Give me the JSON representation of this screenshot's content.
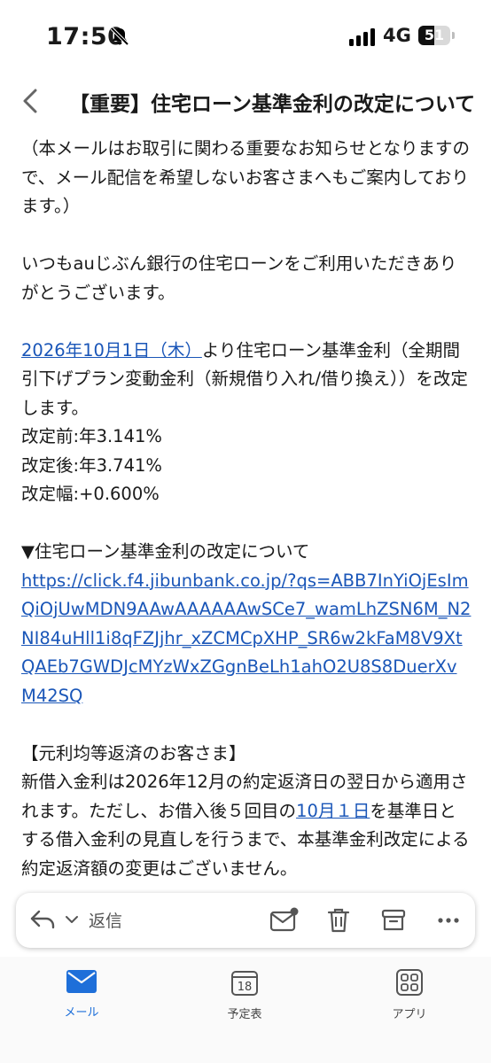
{
  "status_bar": {
    "time": "17:50",
    "network": "4G",
    "battery": "51",
    "battery_level": 0.51
  },
  "header": {
    "subject": "【重要】住宅ローン基準金利の改定について"
  },
  "body": {
    "intro": "（本メールはお取引に関わる重要なお知らせとなりますので、メール配信を希望しないお客さまへもご案内しております。）",
    "greeting": "いつもauじぶん銀行の住宅ローンをご利用いただきありがとうございます。",
    "date_link": "2026年10月1日（木）",
    "announcement_rest": "より住宅ローン基準金利（全期間引下げプラン変動金利（新規借り入れ/借り換え））を改定します。",
    "before": "改定前:年3.141%",
    "after": "改定後:年3.741%",
    "change": "改定幅:+0.600%",
    "section_heading": "▼住宅ローン基準金利の改定について",
    "url": "https://click.f4.jibunbank.co.jp/?qs=ABB7InYiOjEsImQiOjUwMDN9AAwAAAAAAwSCe7_wamLhZSN6M_N2NI84uHll1i8qFZJjhr_xZCMCpXHP_SR6w2kFaM8V9XtQAEb7GWDJcMYzWxZGgnBeLh1ahO2U8S8DuerXvM42SQ",
    "section2_heading": "【元利均等返済のお客さま】",
    "section2_part1": "新借入金利は2026年12月の約定返済日の翌日から適用されます。ただし、お借入後５回目の",
    "section2_link": "10月１日",
    "section2_part2": "を基準日とする借入金利の見直しを行うまで、本基準金利改定による約定返済額の変更はございません。"
  },
  "reply_bar": {
    "reply_label": "返信"
  },
  "tabs": [
    {
      "label": "メール",
      "active": true
    },
    {
      "label": "予定表",
      "active": false,
      "calendar_day": "18"
    },
    {
      "label": "アプリ",
      "active": false
    }
  ],
  "colors": {
    "accent": "#1e6fd9",
    "link": "#1a56b8"
  }
}
